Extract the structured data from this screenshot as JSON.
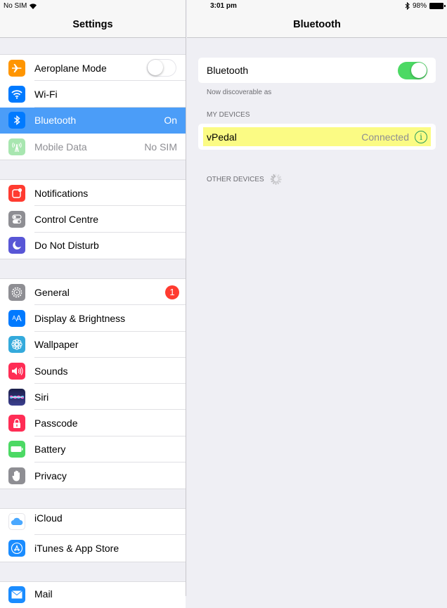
{
  "statusbar": {
    "carrier": "No SIM",
    "time": "3:01 pm",
    "battery": "98%",
    "wifi_icon": "wifi-icon",
    "bluetooth_icon": "bluetooth-icon",
    "battery_icon": "battery-icon"
  },
  "master": {
    "title": "Settings",
    "groups": [
      {
        "items": [
          {
            "label": "Aeroplane Mode",
            "icon": "airplane-icon",
            "color": "#ff9500",
            "toggle": false
          },
          {
            "label": "Wi-Fi",
            "icon": "wifi-icon",
            "color": "#007aff",
            "value": ""
          },
          {
            "label": "Bluetooth",
            "icon": "bluetooth-icon",
            "color": "#007aff",
            "value": "On",
            "selected": true
          },
          {
            "label": "Mobile Data",
            "icon": "antenna-icon",
            "color": "#a8e6b0",
            "value": "No SIM",
            "disabled": true
          }
        ]
      },
      {
        "items": [
          {
            "label": "Notifications",
            "icon": "notifications-icon",
            "color": "#ff3b30"
          },
          {
            "label": "Control Centre",
            "icon": "control-centre-icon",
            "color": "#8e8e93"
          },
          {
            "label": "Do Not Disturb",
            "icon": "moon-icon",
            "color": "#5856d6"
          }
        ]
      },
      {
        "items": [
          {
            "label": "General",
            "icon": "gear-icon",
            "color": "#8e8e93",
            "badge": "1"
          },
          {
            "label": "Display & Brightness",
            "icon": "text-size-icon",
            "color": "#007aff"
          },
          {
            "label": "Wallpaper",
            "icon": "flower-icon",
            "color": "#34aadc"
          },
          {
            "label": "Sounds",
            "icon": "speaker-icon",
            "color": "#ff2d55"
          },
          {
            "label": "Siri",
            "icon": "siri-icon",
            "color": "#2b2f6b"
          },
          {
            "label": "Passcode",
            "icon": "lock-icon",
            "color": "#ff2d55"
          },
          {
            "label": "Battery",
            "icon": "battery-icon",
            "color": "#4cd964"
          },
          {
            "label": "Privacy",
            "icon": "hand-icon",
            "color": "#8e8e93"
          }
        ]
      },
      {
        "items": [
          {
            "label": "iCloud",
            "icon": "cloud-icon",
            "color": "#ffffff"
          },
          {
            "label": "iTunes & App Store",
            "icon": "app-store-icon",
            "color": "#1a8cff"
          }
        ]
      },
      {
        "items": [
          {
            "label": "Mail",
            "icon": "mail-icon",
            "color": "#1a8cff"
          }
        ]
      }
    ]
  },
  "detail": {
    "title": "Bluetooth",
    "bluetooth_label": "Bluetooth",
    "bluetooth_on": true,
    "discoverable_text": "Now discoverable as",
    "my_devices_header": "MY DEVICES",
    "devices": [
      {
        "name": "vPedal",
        "status": "Connected",
        "highlight_color": "#fbfb84"
      }
    ],
    "other_devices_header": "OTHER DEVICES"
  },
  "colors": {
    "selected": "#4b9df8",
    "toggle_on": "#4cd964",
    "badge": "#ff3b30",
    "info_icon": "#2a9d5e"
  }
}
